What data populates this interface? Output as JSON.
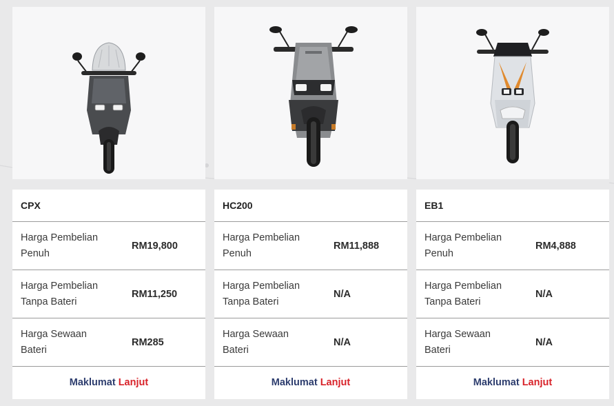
{
  "products": [
    {
      "model": "CPX",
      "image": "cpx-scooter-image",
      "rows": [
        {
          "label_l1": "Harga Pembelian",
          "label_l2": "Penuh",
          "value": "RM19,800"
        },
        {
          "label_l1": "Harga Pembelian",
          "label_l2": "Tanpa Bateri",
          "value": "RM11,250"
        },
        {
          "label_l1": "Harga Sewaan",
          "label_l2": "Bateri",
          "value": "RM285"
        }
      ],
      "more_part1": "Maklumat",
      "more_part2": "Lanjut"
    },
    {
      "model": "HC200",
      "image": "hc200-scooter-image",
      "rows": [
        {
          "label_l1": "Harga Pembelian",
          "label_l2": "Penuh",
          "value": "RM11,888"
        },
        {
          "label_l1": "Harga Pembelian",
          "label_l2": "Tanpa Bateri",
          "value": "N/A"
        },
        {
          "label_l1": "Harga Sewaan",
          "label_l2": "Bateri",
          "value": "N/A"
        }
      ],
      "more_part1": "Maklumat",
      "more_part2": "Lanjut"
    },
    {
      "model": "EB1",
      "image": "eb1-scooter-image",
      "rows": [
        {
          "label_l1": "Harga Pembelian",
          "label_l2": "Penuh",
          "value": "RM4,888"
        },
        {
          "label_l1": "Harga Pembelian",
          "label_l2": "Tanpa Bateri",
          "value": "N/A"
        },
        {
          "label_l1": "Harga Sewaan",
          "label_l2": "Bateri",
          "value": "N/A"
        }
      ],
      "more_part1": "Maklumat",
      "more_part2": "Lanjut"
    }
  ],
  "colors": {
    "page_bg": "#e9e9ea",
    "more_primary": "#2d3d6e",
    "more_accent": "#d8232a",
    "divider": "#9a9a9a"
  }
}
